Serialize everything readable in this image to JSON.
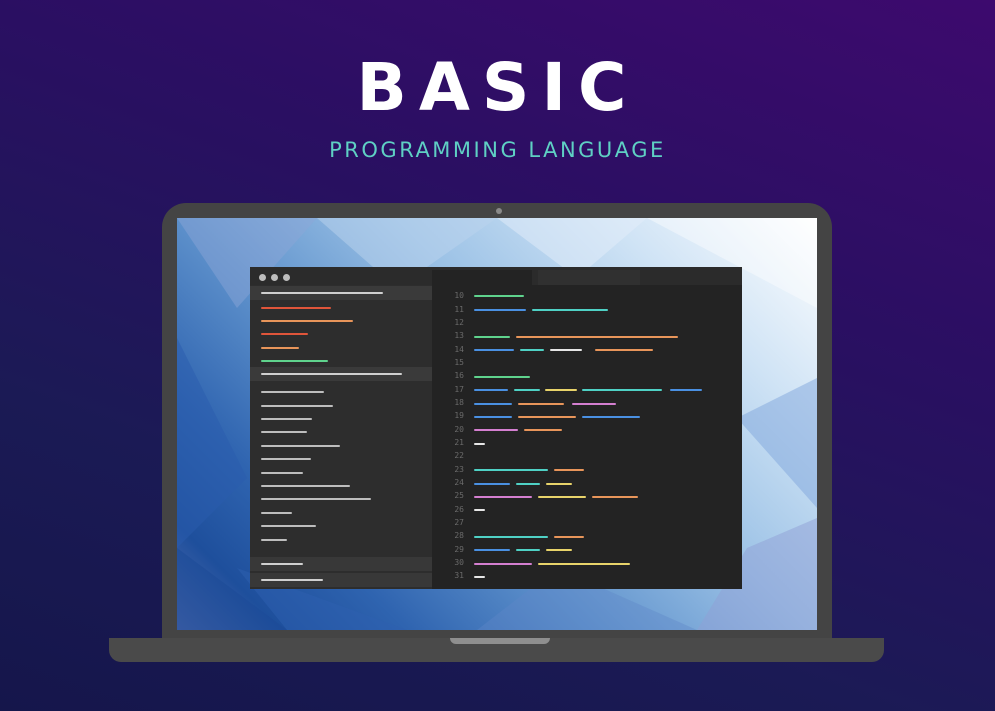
{
  "heading": {
    "title": "BASIC",
    "subtitle": "PROGRAMMING LANGUAGE"
  },
  "colors": {
    "background_top": "#3d0a6e",
    "background_bottom": "#15164b",
    "title": "#ffffff",
    "subtitle": "#5fd0c4",
    "laptop_body": "#444444",
    "editor_bg": "#232323",
    "sidebar_bg": "#2d2d2d",
    "code_green": "#5fd38d",
    "code_blue": "#4a90e2",
    "code_orange": "#e8955a",
    "code_pink": "#d47fd0",
    "code_yellow": "#e8d36a",
    "code_teal": "#4fd1c5",
    "code_red": "#e0553a",
    "code_white": "#e6e6e6"
  },
  "window": {
    "controls": [
      "close-dot",
      "minimize-dot",
      "maximize-dot"
    ]
  },
  "editor": {
    "line_numbers": [
      "10",
      "11",
      "12",
      "13",
      "14",
      "15",
      "16",
      "17",
      "18",
      "19",
      "20",
      "21",
      "22",
      "23",
      "24",
      "25",
      "26",
      "27",
      "28",
      "29",
      "30",
      "31"
    ]
  }
}
